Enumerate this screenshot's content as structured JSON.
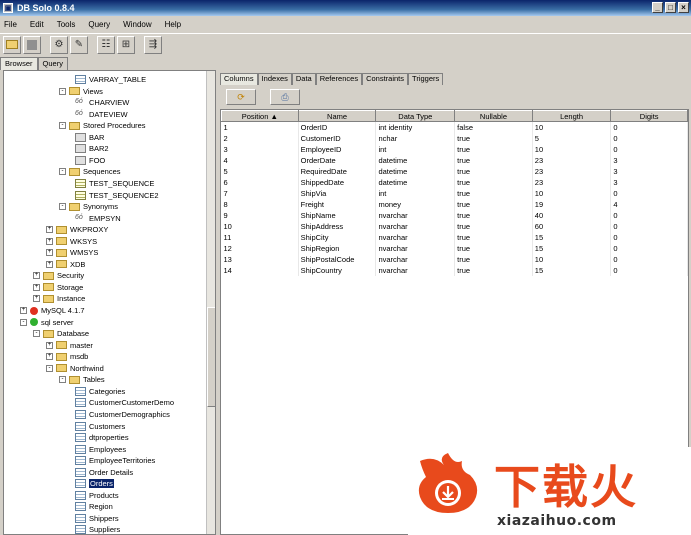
{
  "window": {
    "title": "DB Solo  0.8.4",
    "buttons": [
      "_",
      "□",
      "×"
    ]
  },
  "menu": {
    "items": [
      "File",
      "Edit",
      "Tools",
      "Query",
      "Window",
      "Help"
    ]
  },
  "left_tabs": [
    "Browser",
    "Query"
  ],
  "tree": [
    {
      "label": "VARRAY_TABLE",
      "icon": "table",
      "indent": 5,
      "exp": ""
    },
    {
      "label": "Views",
      "icon": "folder",
      "indent": 3,
      "exp": "-"
    },
    {
      "label": "CHARVIEW",
      "icon": "view",
      "indent": 5,
      "exp": ""
    },
    {
      "label": "DATEVIEW",
      "icon": "view",
      "indent": 5,
      "exp": ""
    },
    {
      "label": "Stored Procedures",
      "icon": "folder",
      "indent": 3,
      "exp": "-"
    },
    {
      "label": "BAR",
      "icon": "proc",
      "indent": 5,
      "exp": ""
    },
    {
      "label": "BAR2",
      "icon": "proc",
      "indent": 5,
      "exp": ""
    },
    {
      "label": "FOO",
      "icon": "proc",
      "indent": 5,
      "exp": ""
    },
    {
      "label": "Sequences",
      "icon": "folder",
      "indent": 3,
      "exp": "-"
    },
    {
      "label": "TEST_SEQUENCE",
      "icon": "seq",
      "indent": 5,
      "exp": ""
    },
    {
      "label": "TEST_SEQUENCE2",
      "icon": "seq",
      "indent": 5,
      "exp": ""
    },
    {
      "label": "Synonyms",
      "icon": "folder",
      "indent": 3,
      "exp": "-"
    },
    {
      "label": "EMPSYN",
      "icon": "view",
      "indent": 5,
      "exp": ""
    },
    {
      "label": "WKPROXY",
      "icon": "folder",
      "indent": 2,
      "exp": "+"
    },
    {
      "label": "WKSYS",
      "icon": "folder",
      "indent": 2,
      "exp": "+"
    },
    {
      "label": "WMSYS",
      "icon": "folder",
      "indent": 2,
      "exp": "+"
    },
    {
      "label": "XDB",
      "icon": "folder",
      "indent": 2,
      "exp": "+"
    },
    {
      "label": "Security",
      "icon": "folder",
      "indent": 1,
      "exp": "+"
    },
    {
      "label": "Storage",
      "icon": "folder",
      "indent": 1,
      "exp": "+"
    },
    {
      "label": "Instance",
      "icon": "folder",
      "indent": 1,
      "exp": "+"
    },
    {
      "label": "MySQL 4.1.7",
      "icon": "db-red",
      "indent": 0,
      "exp": "+"
    },
    {
      "label": "sql server",
      "icon": "db-green",
      "indent": 0,
      "exp": "-"
    },
    {
      "label": "Database",
      "icon": "folder",
      "indent": 1,
      "exp": "-"
    },
    {
      "label": "master",
      "icon": "folder",
      "indent": 2,
      "exp": "+"
    },
    {
      "label": "msdb",
      "icon": "folder",
      "indent": 2,
      "exp": "+"
    },
    {
      "label": "Northwind",
      "icon": "folder",
      "indent": 2,
      "exp": "-"
    },
    {
      "label": "Tables",
      "icon": "folder",
      "indent": 3,
      "exp": "-"
    },
    {
      "label": "Categories",
      "icon": "table",
      "indent": 5,
      "exp": ""
    },
    {
      "label": "CustomerCustomerDemo",
      "icon": "table",
      "indent": 5,
      "exp": ""
    },
    {
      "label": "CustomerDemographics",
      "icon": "table",
      "indent": 5,
      "exp": ""
    },
    {
      "label": "Customers",
      "icon": "table",
      "indent": 5,
      "exp": ""
    },
    {
      "label": "dtproperties",
      "icon": "table",
      "indent": 5,
      "exp": ""
    },
    {
      "label": "Employees",
      "icon": "table",
      "indent": 5,
      "exp": ""
    },
    {
      "label": "EmployeeTerritories",
      "icon": "table",
      "indent": 5,
      "exp": ""
    },
    {
      "label": "Order Details",
      "icon": "table",
      "indent": 5,
      "exp": ""
    },
    {
      "label": "Orders",
      "icon": "table",
      "indent": 5,
      "exp": "",
      "selected": true
    },
    {
      "label": "Products",
      "icon": "table",
      "indent": 5,
      "exp": ""
    },
    {
      "label": "Region",
      "icon": "table",
      "indent": 5,
      "exp": ""
    },
    {
      "label": "Shippers",
      "icon": "table",
      "indent": 5,
      "exp": ""
    },
    {
      "label": "Suppliers",
      "icon": "table",
      "indent": 5,
      "exp": ""
    }
  ],
  "right_tabs": [
    "Columns",
    "Indexes",
    "Data",
    "References",
    "Constraints",
    "Triggers"
  ],
  "columns_table": {
    "headers": [
      "Position ▲",
      "Name",
      "Data Type",
      "Nullable",
      "Length",
      "Digits"
    ],
    "rows": [
      [
        "1",
        "OrderID",
        "int identity",
        "false",
        "10",
        "0"
      ],
      [
        "2",
        "CustomerID",
        "nchar",
        "true",
        "5",
        "0"
      ],
      [
        "3",
        "EmployeeID",
        "int",
        "true",
        "10",
        "0"
      ],
      [
        "4",
        "OrderDate",
        "datetime",
        "true",
        "23",
        "3"
      ],
      [
        "5",
        "RequiredDate",
        "datetime",
        "true",
        "23",
        "3"
      ],
      [
        "6",
        "ShippedDate",
        "datetime",
        "true",
        "23",
        "3"
      ],
      [
        "7",
        "ShipVia",
        "int",
        "true",
        "10",
        "0"
      ],
      [
        "8",
        "Freight",
        "money",
        "true",
        "19",
        "4"
      ],
      [
        "9",
        "ShipName",
        "nvarchar",
        "true",
        "40",
        "0"
      ],
      [
        "10",
        "ShipAddress",
        "nvarchar",
        "true",
        "60",
        "0"
      ],
      [
        "11",
        "ShipCity",
        "nvarchar",
        "true",
        "15",
        "0"
      ],
      [
        "12",
        "ShipRegion",
        "nvarchar",
        "true",
        "15",
        "0"
      ],
      [
        "13",
        "ShipPostalCode",
        "nvarchar",
        "true",
        "10",
        "0"
      ],
      [
        "14",
        "ShipCountry",
        "nvarchar",
        "true",
        "15",
        "0"
      ]
    ]
  },
  "watermark": {
    "cn": "下载火",
    "en": "xiazaihuo.com"
  },
  "colors": {
    "title_start": "#0a246a",
    "selection": "#0a246a",
    "watermark": "#e84a1c"
  }
}
